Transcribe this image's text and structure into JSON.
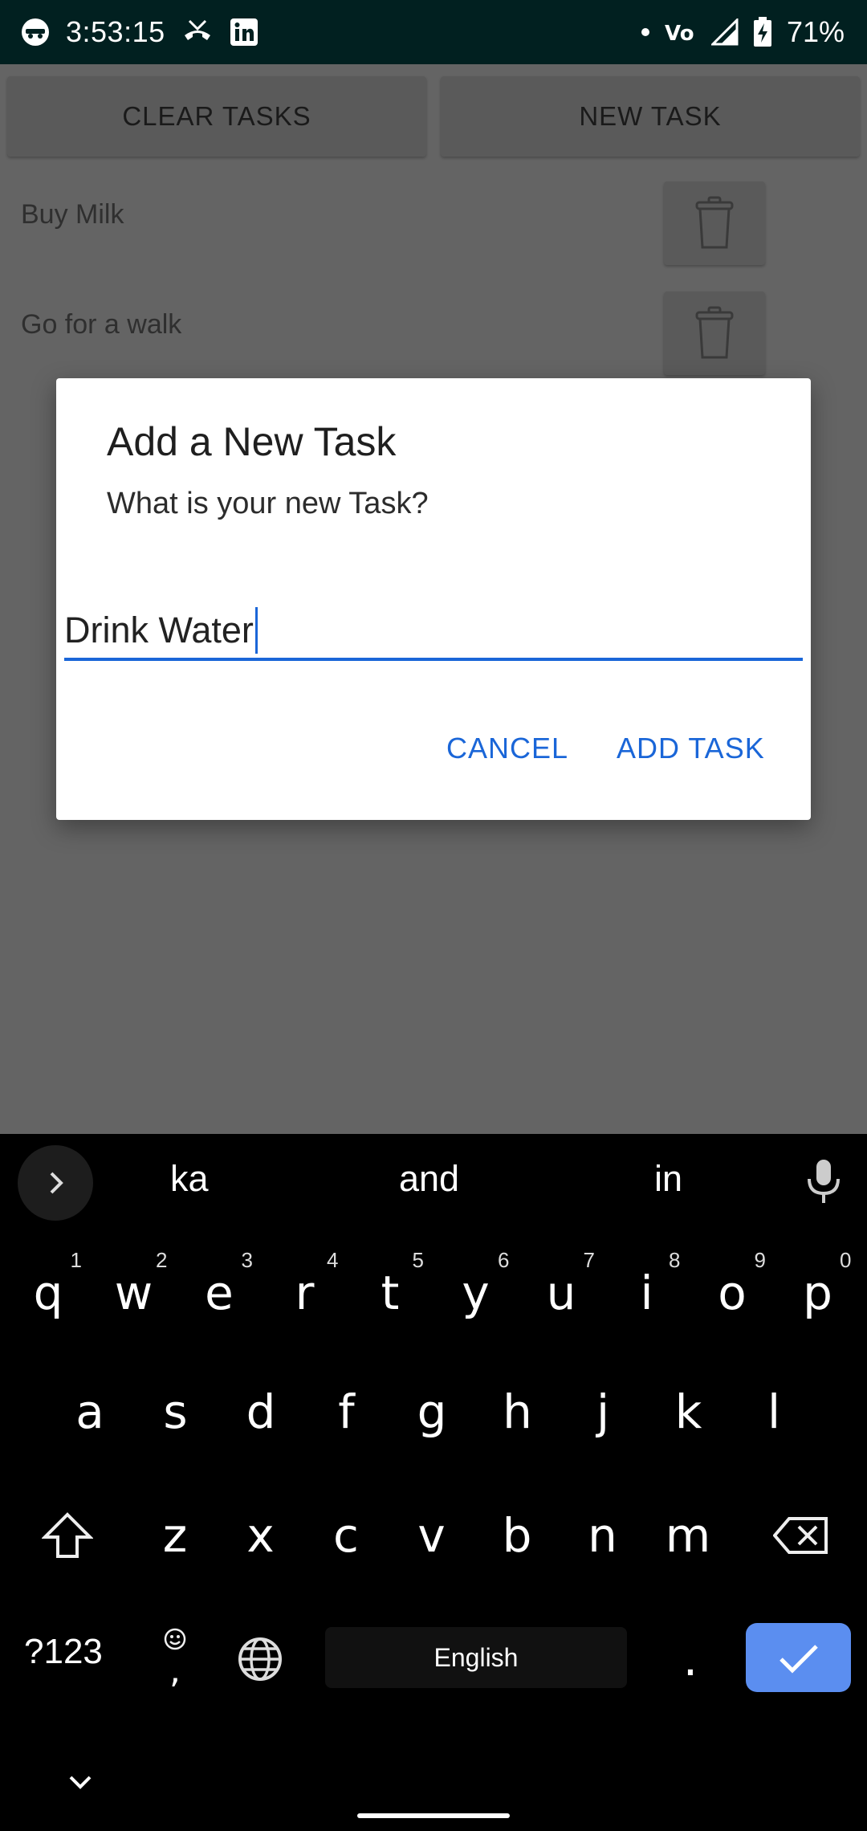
{
  "status_bar": {
    "time": "3:53:15",
    "battery": "71%",
    "left_icons": [
      "incognito-icon",
      "missed-call-icon",
      "linkedin-icon"
    ],
    "right_icons": [
      "dot-icon",
      "volte-icon",
      "signal-icon",
      "battery-charging-icon"
    ]
  },
  "app": {
    "clear_button": "CLEAR TASKS",
    "new_button": "NEW TASK",
    "tasks": [
      {
        "label": "Buy Milk",
        "icon": "trash-icon"
      },
      {
        "label": "Go for a walk",
        "icon": "trash-icon"
      }
    ]
  },
  "dialog": {
    "title": "Add a New Task",
    "message": "What is your new Task?",
    "input_value": "Drink Water",
    "cancel": "CANCEL",
    "confirm": "ADD TASK",
    "accent": "#1a66d8"
  },
  "keyboard": {
    "suggestions": [
      "ka",
      "and",
      "in"
    ],
    "row1": [
      {
        "k": "q",
        "n": "1"
      },
      {
        "k": "w",
        "n": "2"
      },
      {
        "k": "e",
        "n": "3"
      },
      {
        "k": "r",
        "n": "4"
      },
      {
        "k": "t",
        "n": "5"
      },
      {
        "k": "y",
        "n": "6"
      },
      {
        "k": "u",
        "n": "7"
      },
      {
        "k": "i",
        "n": "8"
      },
      {
        "k": "o",
        "n": "9"
      },
      {
        "k": "p",
        "n": "0"
      }
    ],
    "row2": [
      "a",
      "s",
      "d",
      "f",
      "g",
      "h",
      "j",
      "k",
      "l"
    ],
    "row3": [
      "z",
      "x",
      "c",
      "v",
      "b",
      "n",
      "m"
    ],
    "symbols": "?123",
    "comma": ",",
    "period": ".",
    "space": "English",
    "enter_color": "#5b8ef0"
  }
}
